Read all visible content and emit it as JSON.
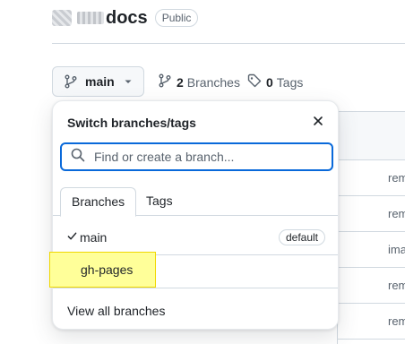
{
  "repo": {
    "name_suffix": "docs",
    "visibility": "Public"
  },
  "branch_button": {
    "label": "main"
  },
  "meta": {
    "branches_count": "2",
    "branches_label": "Branches",
    "tags_count": "0",
    "tags_label": "Tags"
  },
  "file_rows": [
    "rem",
    "rem",
    "ima",
    "rem",
    "rem"
  ],
  "popover": {
    "title": "Switch branches/tags",
    "search_placeholder": "Find or create a branch...",
    "tabs": [
      "Branches",
      "Tags"
    ],
    "branches": [
      {
        "name": "main",
        "badge": "default"
      },
      {
        "name": "gh-pages"
      }
    ],
    "view_all": "View all branches"
  },
  "colors": {
    "focus": "#0969da",
    "highlight": "#ffff99",
    "border": "#d1d9e0"
  },
  "icons": [
    "git-branch-icon",
    "caret-down-icon",
    "tag-icon",
    "close-icon",
    "search-icon",
    "check-icon"
  ]
}
